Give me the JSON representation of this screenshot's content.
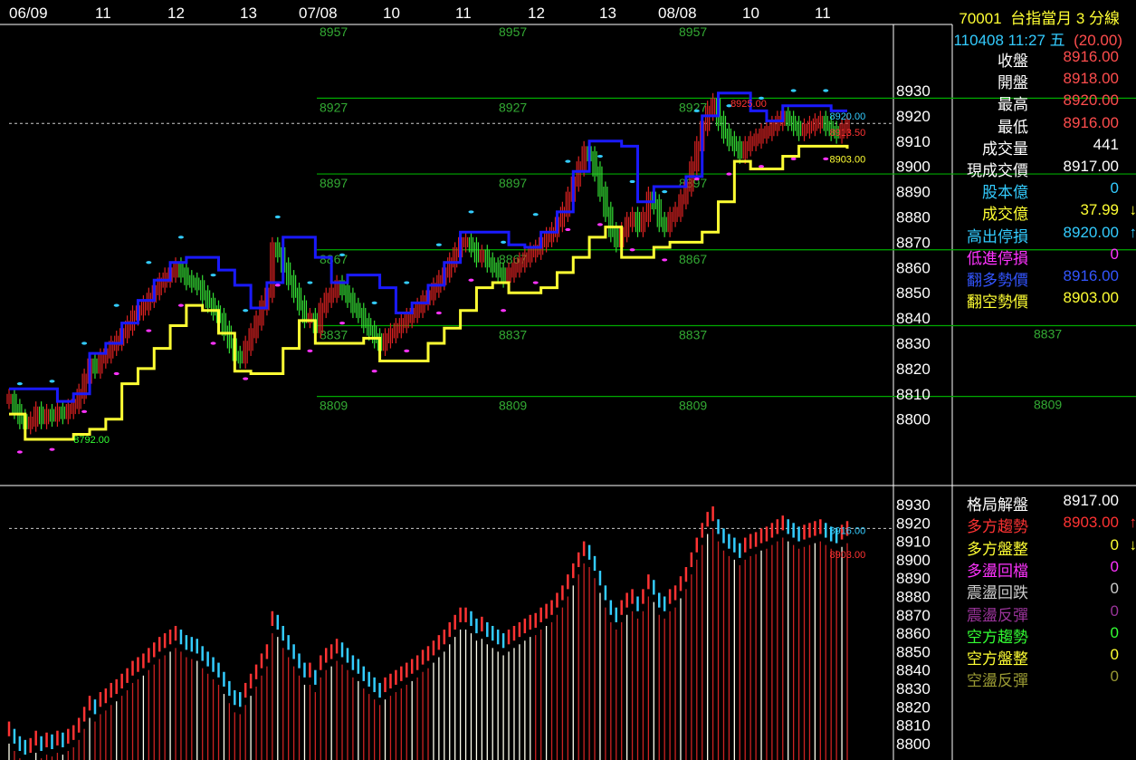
{
  "header": {
    "symbol": "70001",
    "title": "台指當月 3 分線",
    "datetime": "110408 11:27 五",
    "change": "(20.00)"
  },
  "quote": [
    {
      "label": "收盤",
      "value": "8916.00",
      "label_color": "#ffffff",
      "value_color": "#ff4d4d"
    },
    {
      "label": "開盤",
      "value": "8918.00",
      "label_color": "#ffffff",
      "value_color": "#ff4d4d"
    },
    {
      "label": "最高",
      "value": "8920.00",
      "label_color": "#ffffff",
      "value_color": "#ff4d4d"
    },
    {
      "label": "最低",
      "value": "8916.00",
      "label_color": "#ffffff",
      "value_color": "#ff4d4d"
    },
    {
      "label": "成交量",
      "value": "441",
      "label_color": "#ffffff",
      "value_color": "#ffffff"
    },
    {
      "label": "現成交價",
      "value": "8917.00",
      "label_color": "#ffffff",
      "value_color": "#ffffff"
    },
    {
      "label": "股本億",
      "value": "0",
      "label_color": "#33ccff",
      "value_color": "#33ccff"
    },
    {
      "label": "成交億",
      "value": "37.99",
      "arrow": "↓",
      "label_color": "#ffff33",
      "value_color": "#ffff33",
      "arrow_color": "#ffff33"
    },
    {
      "label": "高出停損",
      "value": "8920.00",
      "arrow": "↑",
      "label_color": "#33ccff",
      "value_color": "#33ccff",
      "arrow_color": "#33ccff"
    },
    {
      "label": "低進停損",
      "value": "0",
      "label_color": "#ff33ff",
      "value_color": "#ff33ff"
    },
    {
      "label": "翻多勢價",
      "value": "8916.00",
      "label_color": "#3355ff",
      "value_color": "#3355ff"
    },
    {
      "label": "翻空勢價",
      "value": "8903.00",
      "label_color": "#ffff33",
      "value_color": "#ffff33"
    }
  ],
  "pattern": [
    {
      "label": "格局解盤",
      "value": "8917.00",
      "label_color": "#ffffff",
      "value_color": "#ffffff"
    },
    {
      "label": "多方趨勢",
      "value": "8903.00",
      "arrow": "↑",
      "label_color": "#ff3333",
      "value_color": "#ff3333",
      "arrow_color": "#ff3333"
    },
    {
      "label": "多方盤整",
      "value": "0",
      "arrow": "↓",
      "label_color": "#ffff33",
      "value_color": "#ffff33",
      "arrow_color": "#ffff33"
    },
    {
      "label": "多盪回檔",
      "value": "0",
      "label_color": "#ff33ff",
      "value_color": "#ff33ff"
    },
    {
      "label": "震盪回跌",
      "value": "0",
      "label_color": "#cccccc",
      "value_color": "#cccccc"
    },
    {
      "label": "震盪反彈",
      "value": "0",
      "label_color": "#993399",
      "value_color": "#993399"
    },
    {
      "label": "空方趨勢",
      "value": "0",
      "label_color": "#33ff33",
      "value_color": "#33ff33"
    },
    {
      "label": "空方盤整",
      "value": "0",
      "label_color": "#ffff33",
      "value_color": "#ffff33"
    },
    {
      "label": "空盪反彈",
      "value": "0",
      "label_color": "#999933",
      "value_color": "#999933"
    }
  ],
  "chart_data": {
    "type": "bar",
    "x_ticks": [
      "06/09",
      "11",
      "12",
      "13",
      "07/08",
      "10",
      "11",
      "12",
      "13",
      "08/08",
      "10",
      "11"
    ],
    "top": {
      "yticks": [
        8930,
        8920,
        8910,
        8900,
        8890,
        8880,
        8870,
        8860,
        8850,
        8840,
        8830,
        8820,
        8810,
        8800
      ],
      "last_price": 8917,
      "levels": [
        {
          "value": 8957,
          "label": "8957"
        },
        {
          "value": 8927,
          "label": "8927"
        },
        {
          "value": 8897,
          "label": "8897"
        },
        {
          "value": 8867,
          "label": "8867"
        },
        {
          "value": 8837,
          "label": "8837"
        },
        {
          "value": 8809,
          "label": "8809"
        }
      ],
      "annotations": [
        {
          "x": 204,
          "y": 8925,
          "text": "8925.00",
          "color": "#ff3333"
        },
        {
          "x": 12,
          "y": 8792,
          "text": "8792.00",
          "color": "#33ff33"
        },
        {
          "x": 232,
          "y": 8920,
          "text": "8920.00",
          "color": "#33ccff"
        },
        {
          "x": 232,
          "y": 8913.5,
          "text": "8913.50",
          "color": "#ff3333"
        },
        {
          "x": 232,
          "y": 8903,
          "text": "8903.00",
          "color": "#ffff33"
        }
      ],
      "close": [
        8808,
        8804,
        8800,
        8798,
        8799,
        8803,
        8800,
        8802,
        8801,
        8803,
        8802,
        8804,
        8806,
        8810,
        8816,
        8822,
        8820,
        8824,
        8826,
        8829,
        8831,
        8834,
        8837,
        8841,
        8843,
        8845,
        8848,
        8851,
        8854,
        8856,
        8858,
        8860,
        8858,
        8855,
        8854,
        8853,
        8849,
        8846,
        8843,
        8840,
        8835,
        8830,
        8825,
        8824,
        8829,
        8834,
        8839,
        8845,
        8850,
        8868,
        8866,
        8860,
        8855,
        8850,
        8845,
        8840,
        8840,
        8836,
        8844,
        8848,
        8850,
        8853,
        8851,
        8848,
        8844,
        8842,
        8838,
        8835,
        8832,
        8829,
        8832,
        8834,
        8836,
        8838,
        8840,
        8842,
        8844,
        8847,
        8849,
        8852,
        8855,
        8858,
        8862,
        8866,
        8870,
        8870,
        8868,
        8864,
        8865,
        8862,
        8860,
        8858,
        8856,
        8858,
        8860,
        8862,
        8864,
        8866,
        8867,
        8870,
        8872,
        8874,
        8878,
        8882,
        8888,
        8894,
        8900,
        8906,
        8904,
        8898,
        8890,
        8882,
        8874,
        8870,
        8874,
        8878,
        8880,
        8876,
        8880,
        8888,
        8885,
        8878,
        8876,
        8880,
        8882,
        8887,
        8892,
        8900,
        8908,
        8916,
        8922,
        8925,
        8918,
        8913,
        8910,
        8908,
        8905,
        8908,
        8910,
        8911,
        8913,
        8914,
        8916,
        8918,
        8920,
        8918,
        8916,
        8914,
        8915,
        8916,
        8917,
        8918,
        8916,
        8914,
        8913,
        8915,
        8917
      ]
    },
    "bottom": {
      "yticks": [
        8930,
        8920,
        8910,
        8900,
        8890,
        8880,
        8870,
        8860,
        8850,
        8840,
        8830,
        8820,
        8810,
        8800
      ],
      "annotations": [
        {
          "x": 232,
          "y": 8916,
          "text": "8916.00",
          "color": "#33ccff"
        },
        {
          "x": 232,
          "y": 8903,
          "text": "8903.00",
          "color": "#ff3333"
        }
      ]
    }
  }
}
